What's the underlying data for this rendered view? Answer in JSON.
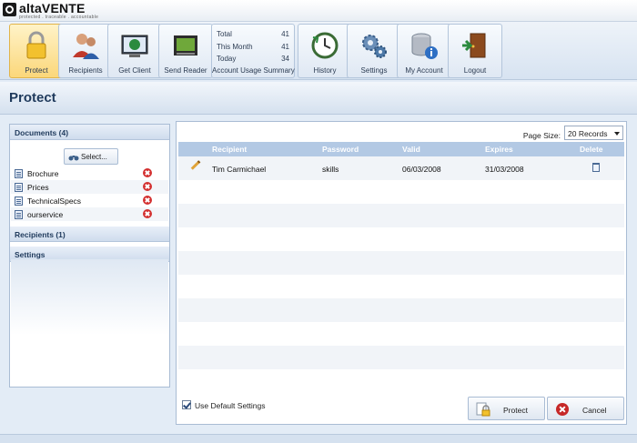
{
  "brand": {
    "name": "altaVENTE",
    "tagline": "protected . traceable . accountable"
  },
  "toolbar": {
    "tools": [
      {
        "label": "Protect",
        "icon": "padlock-icon",
        "active": true
      },
      {
        "label": "Recipients",
        "icon": "people-icon"
      },
      {
        "label": "Get Client",
        "icon": "monitor-globe-icon"
      },
      {
        "label": "Send Reader",
        "icon": "reader-icon"
      },
      {
        "label": "History",
        "icon": "clock-history-icon"
      },
      {
        "label": "Settings",
        "icon": "gears-icon"
      },
      {
        "label": "My Account",
        "icon": "database-info-icon"
      },
      {
        "label": "Logout",
        "icon": "door-exit-icon"
      }
    ],
    "summary": {
      "label": "Account Usage Summary",
      "rows": [
        {
          "name": "Total",
          "value": "41"
        },
        {
          "name": "This Month",
          "value": "41"
        },
        {
          "name": "Today",
          "value": "34"
        }
      ]
    }
  },
  "page": {
    "title": "Protect"
  },
  "left": {
    "documents_header": "Documents (4)",
    "select_label": "Select...",
    "documents": [
      "Brochure",
      "Prices",
      "TechnicalSpecs",
      "ourservice"
    ],
    "recipients_header": "Recipients (1)",
    "settings_header": "Settings"
  },
  "grid": {
    "page_size_label": "Page Size:",
    "page_size_value": "20 Records",
    "columns": [
      "Recipient",
      "Password",
      "Valid",
      "Expires",
      "Delete"
    ],
    "rows": [
      {
        "recipient": "Tim Carmichael",
        "password": "skills",
        "valid": "06/03/2008",
        "expires": "31/03/2008"
      }
    ]
  },
  "footer_controls": {
    "use_default_label": "Use Default Settings",
    "use_default_checked": true,
    "protect_label": "Protect",
    "cancel_label": "Cancel"
  },
  "colors": {
    "active_tool": "#fbd77a",
    "header_blue": "#b3c9e4",
    "title_text": "#1f3a5c"
  }
}
